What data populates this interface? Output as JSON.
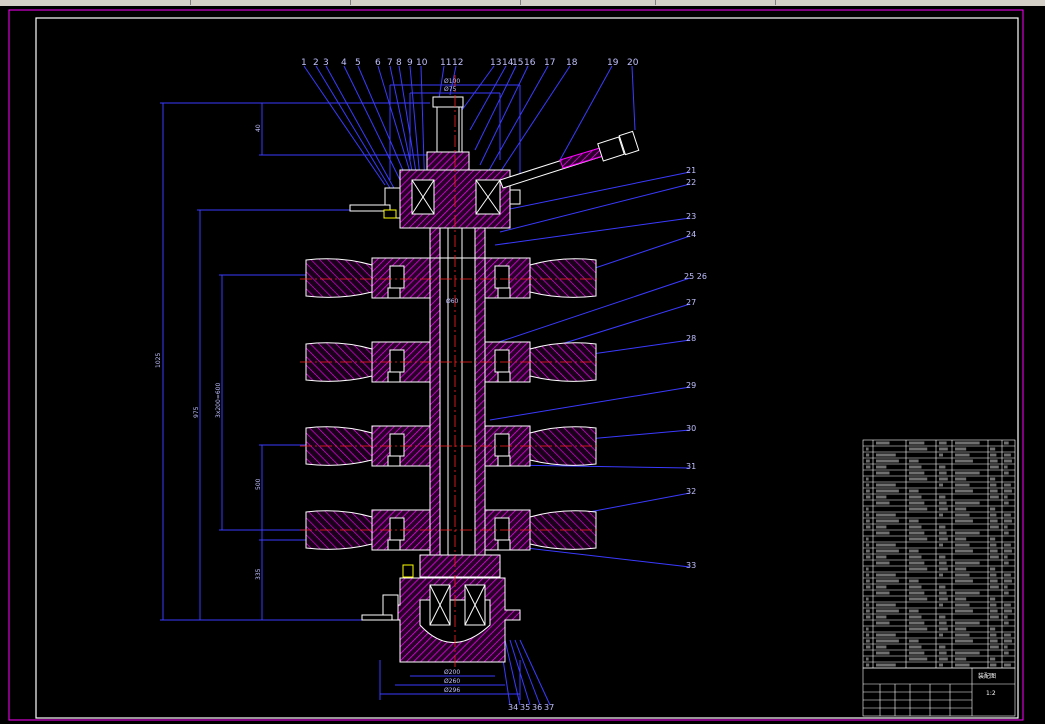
{
  "window": {
    "app": "CAD drawing viewer"
  },
  "callouts": [
    "1",
    "2",
    "3",
    "4",
    "5",
    "6",
    "7",
    "8",
    "9",
    "10",
    "11",
    "12",
    "13",
    "14",
    "15",
    "16",
    "17",
    "18",
    "19",
    "20"
  ],
  "right_callouts": [
    "21",
    "22",
    "23",
    "24",
    "25 26",
    "27",
    "28",
    "29",
    "30",
    "31",
    "32",
    "33",
    "34",
    "35",
    "36",
    "37"
  ],
  "dimensions": {
    "total_height": "1025",
    "upper_height": "975",
    "pitch_span": "3x200=600",
    "lower_span": "500",
    "lower_offset": "335",
    "top_gap": "40",
    "mid_width": "Ø60",
    "top_width_a": "Ø100",
    "top_width_b": "Ø75",
    "bottom_width_a": "Ø200",
    "bottom_width_b": "Ø260",
    "bottom_width_c": "Ø296"
  },
  "colors": {
    "background": "#000000",
    "frame": "#ff00ff",
    "outline": "#ffffff",
    "leader": "#3a3aff",
    "hatch": "#ff00ff",
    "centerline": "#ff2020",
    "bearing": "#ffffff",
    "bolt": "#ffff00",
    "table_line": "#ffffff"
  },
  "title_block": {
    "title": "装配图",
    "scale": "1:2"
  }
}
